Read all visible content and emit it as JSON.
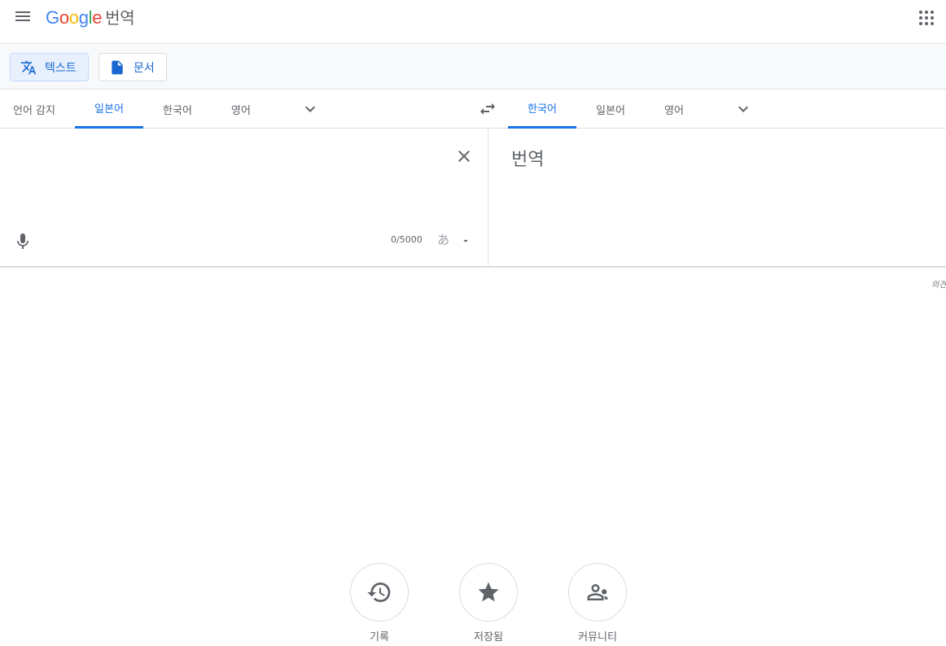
{
  "header": {
    "logo_letters": [
      "G",
      "o",
      "o",
      "g",
      "l",
      "e"
    ],
    "product": "번역"
  },
  "modes": {
    "text_label": "텍스트",
    "document_label": "문서"
  },
  "source_langs": [
    "언어 감지",
    "일본어",
    "한국어",
    "영어"
  ],
  "target_langs": [
    "한국어",
    "일본어",
    "영어"
  ],
  "source": {
    "value": "",
    "char_count": "0/5000",
    "ime_char": "あ"
  },
  "target": {
    "placeholder": "번역"
  },
  "feedback": "의견",
  "bottom": {
    "history_label": "기록",
    "saved_label": "저장됨",
    "community_label": "커뮤니티"
  },
  "colors": {
    "accent": "#1a73e8",
    "icon": "#5f6368"
  },
  "icons": {
    "menu": "hamburger-icon",
    "apps": "apps-grid-icon",
    "translate": "translate-icon",
    "document": "document-icon",
    "chevron": "chevron-down-icon",
    "swap": "swap-icon",
    "clear": "close-icon",
    "mic": "mic-icon",
    "history": "history-icon",
    "star": "star-icon",
    "community": "community-icon"
  }
}
